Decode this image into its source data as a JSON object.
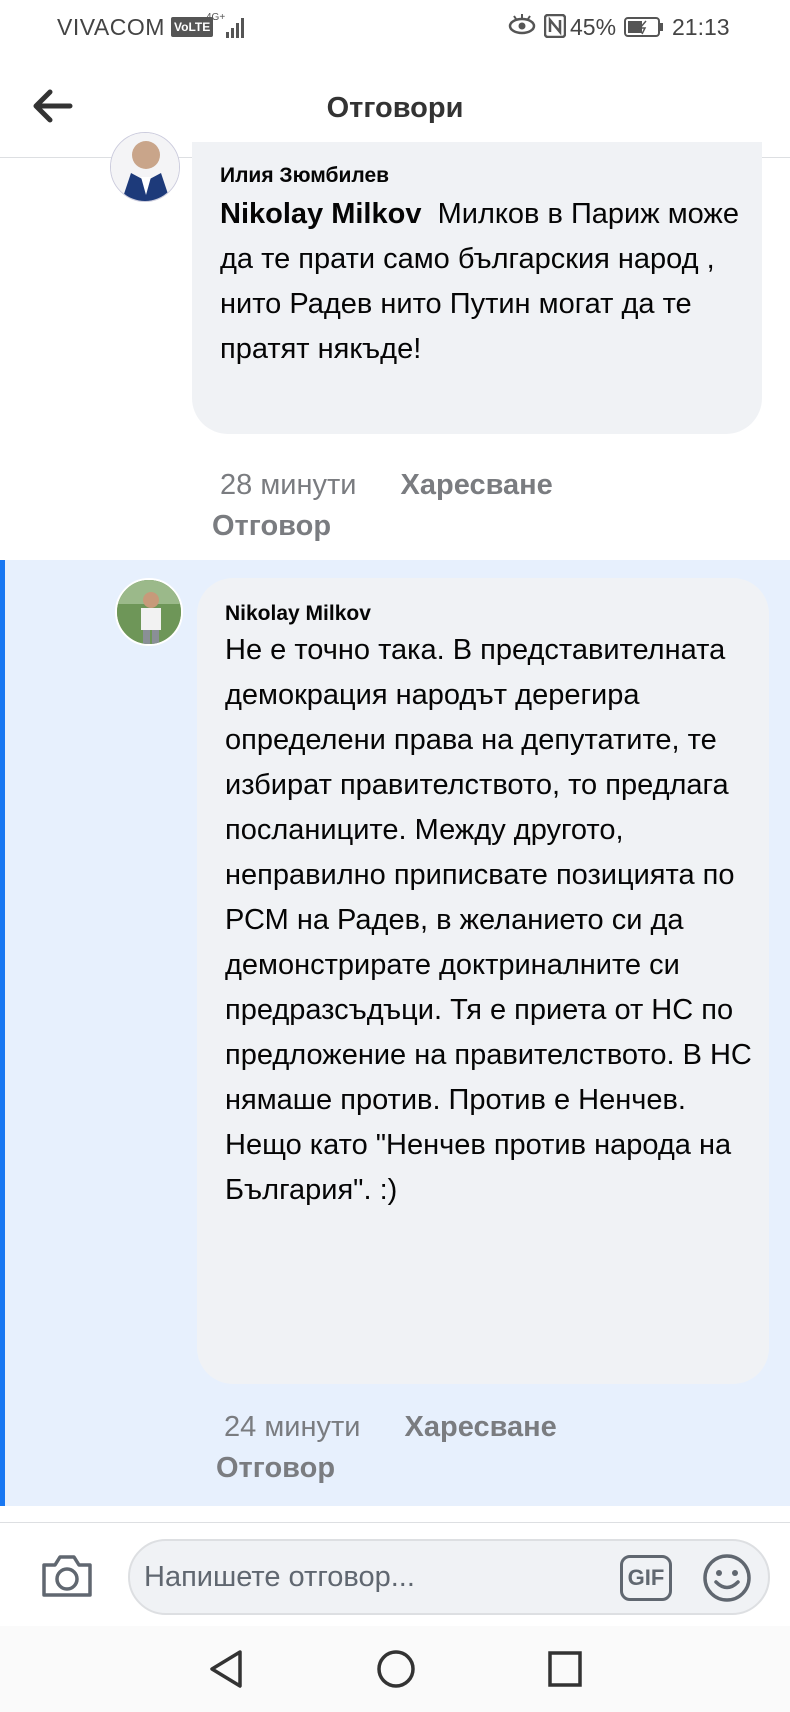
{
  "status_bar": {
    "carrier": "VIVACOM",
    "volte": "VoLTE",
    "network": "4G+",
    "battery_percent": "45%",
    "time": "21:13"
  },
  "header": {
    "title": "Отговори"
  },
  "comments": [
    {
      "author": "Илия Зюмбилев",
      "mention": "Nikolay Milkov",
      "text": "Милков в Париж може да те прати само българския народ , нито Радев нито Путин могат да те пратят някъде!",
      "time": "28 минути",
      "like_label": "Харесване",
      "reply_label": "Отговор"
    },
    {
      "author": "Nikolay Milkov",
      "text": "Не е точно така. В представителната демокрация народът дерегира определени права на депутатите, те избират правителството, то предлага посланиците. Между другото, неправилно приписвате позицията по РСМ на Радев, в желанието си да демонстрирате доктриналните си предразсъдъци. Тя е приета от НС по предложение на правителството. В НС нямаше против. Против е Ненчев. Нещо като \"Ненчев против народа на България\". :)",
      "time": "24 минути",
      "like_label": "Харесване",
      "reply_label": "Отговор"
    }
  ],
  "composer": {
    "placeholder": "Напишете отговор...",
    "gif_label": "GIF"
  },
  "icons": {
    "back": "arrow-left-icon",
    "camera": "camera-icon",
    "emoji": "emoji-icon",
    "nav_back": "triangle-back-icon",
    "nav_home": "circle-home-icon",
    "nav_recent": "square-recent-icon"
  },
  "colors": {
    "highlight_bg": "#e7f0fd",
    "highlight_border": "#1877f2",
    "bubble_bg": "#f0f2f5",
    "meta_text": "#7a7c80"
  }
}
